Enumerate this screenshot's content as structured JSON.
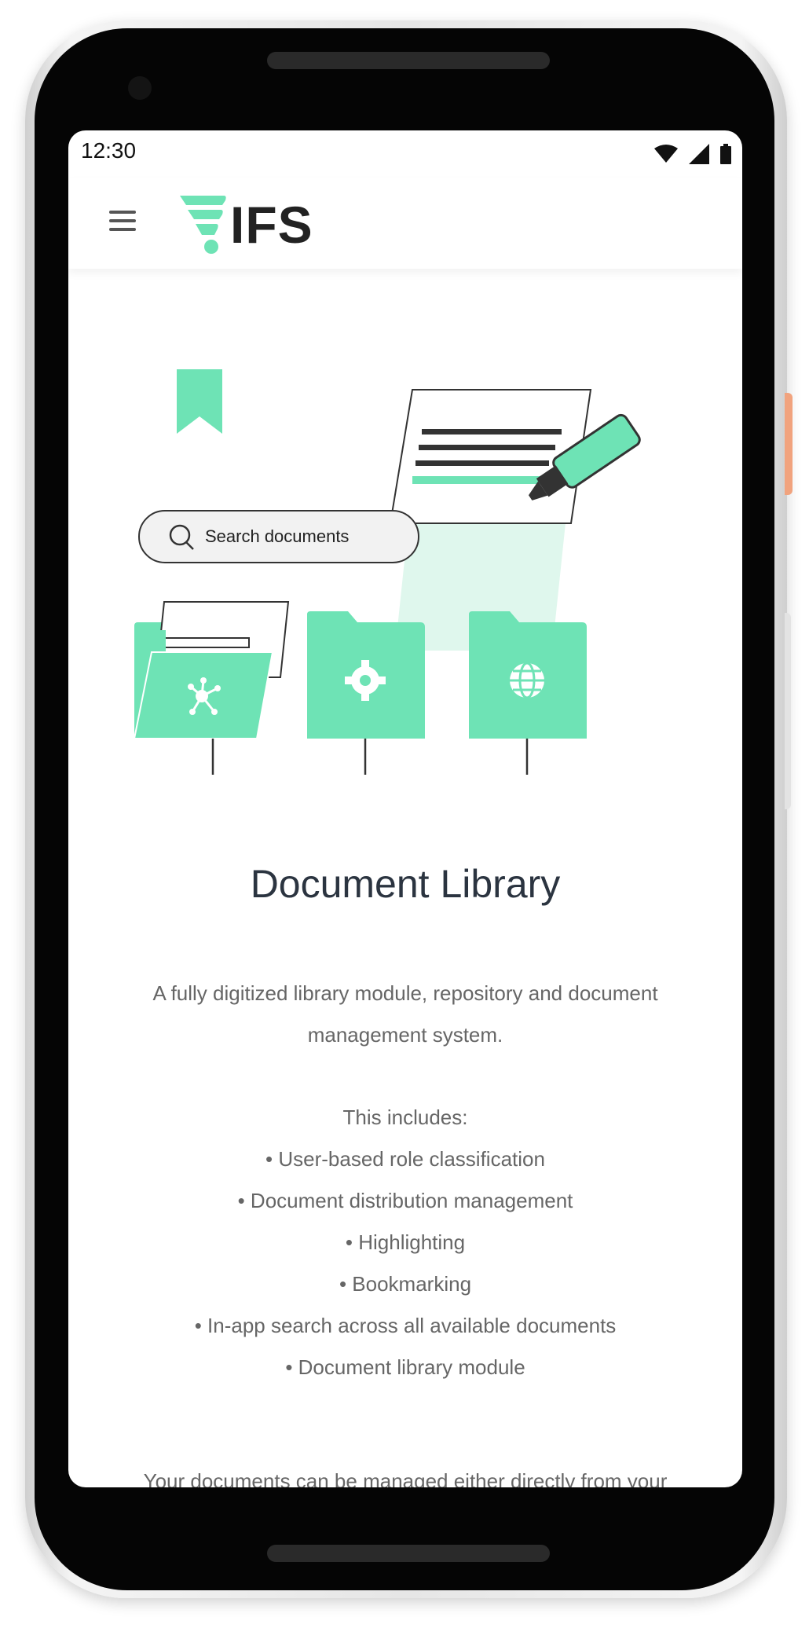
{
  "status_bar": {
    "time": "12:30"
  },
  "app_bar": {
    "logo_text": "IFS"
  },
  "illustration": {
    "search_placeholder": "Search documents"
  },
  "main": {
    "title": "Document Library",
    "description": "A fully digitized library module, repository and document management system.",
    "includes_heading": "This includes:",
    "features": [
      "• User-based role classification",
      "• Document distribution management",
      "• Highlighting",
      "• Bookmarking",
      "• In-app search across all available documents",
      "• Document library module"
    ],
    "cut_off_text": "Your documents can be managed either directly from your"
  },
  "colors": {
    "accent": "#6ee3b5",
    "text_dark": "#2b3440",
    "text_muted": "#666666"
  }
}
